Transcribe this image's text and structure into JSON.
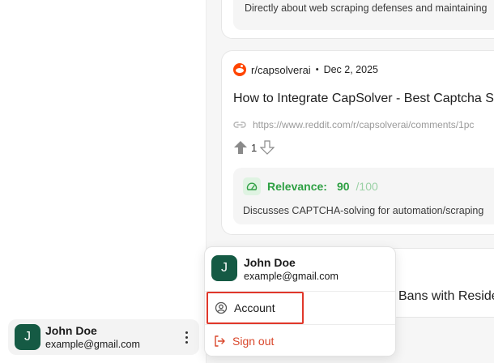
{
  "feed": {
    "card1": {
      "summary": "Directly about web scraping defenses and maintaining"
    },
    "card2": {
      "subreddit": "r/capsolverai",
      "separator": "•",
      "date": "Dec 2, 2025",
      "title": "How to Integrate CapSolver - Best Captcha S",
      "link": "https://www.reddit.com/r/capsolverai/comments/1pc",
      "upvotes": "1",
      "relevance_label": "Relevance:",
      "relevance_score": "90",
      "relevance_max": "/100",
      "summary": "Discusses CAPTCHA-solving for automation/scraping"
    },
    "card3": {
      "title": "Bans with Reside"
    }
  },
  "user": {
    "initial": "J",
    "name": "John Doe",
    "email": "example@gmail.com"
  },
  "menu": {
    "account_label": "Account",
    "signout_label": "Sign out"
  },
  "colors": {
    "avatar_bg": "#155a44",
    "relevance_green": "#2ea043",
    "signout_red": "#d9472b",
    "highlight_red": "#e0372a",
    "reddit_orange": "#ff4500"
  }
}
